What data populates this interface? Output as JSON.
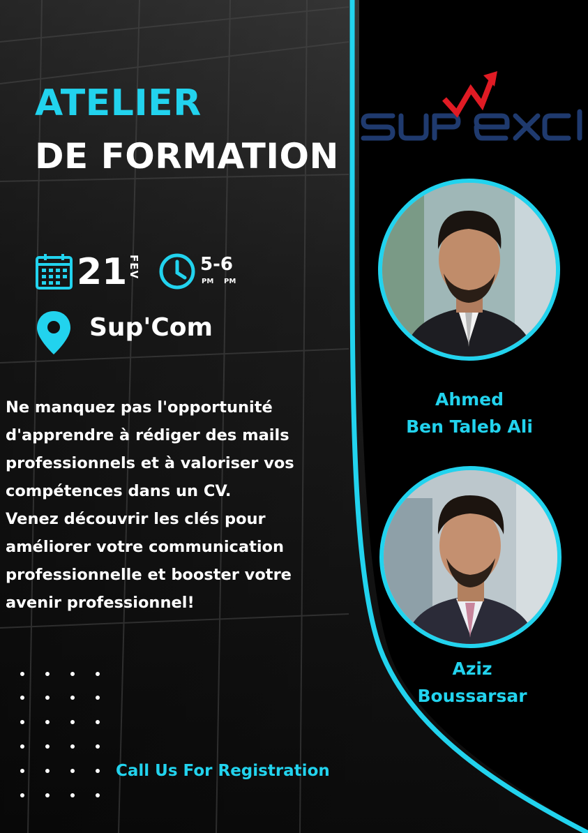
{
  "title": {
    "line1": "ATELIER",
    "line2": "DE FORMATION"
  },
  "event": {
    "day": "21",
    "month": "FEV",
    "time": "5-6",
    "time_start_period": "PM",
    "time_end_period": "PM",
    "location": "Sup'Com"
  },
  "description_lines": [
    "Ne manquez pas  l'opportunité",
    "d'apprendre à rédiger des mails",
    "professionnels et à valoriser vos",
    "compétences dans un CV.",
    "Venez découvrir les clés pour",
    "améliorer votre communication",
    "professionnelle et booster votre",
    "avenir professionnel!"
  ],
  "logo": {
    "text": "SUP EXCEL"
  },
  "speakers": [
    {
      "first": "Ahmed",
      "last": "Ben Taleb Ali"
    },
    {
      "first": "Aziz",
      "last": "Boussarsar"
    }
  ],
  "cta": "Call Us For Registration",
  "colors": {
    "accent": "#22d3ee",
    "logo_blue": "#1f3a6e",
    "logo_red": "#e01b24",
    "background": "#000000"
  },
  "icons": [
    "calendar-icon",
    "clock-icon",
    "location-pin-icon",
    "logo-arrow-icon"
  ]
}
